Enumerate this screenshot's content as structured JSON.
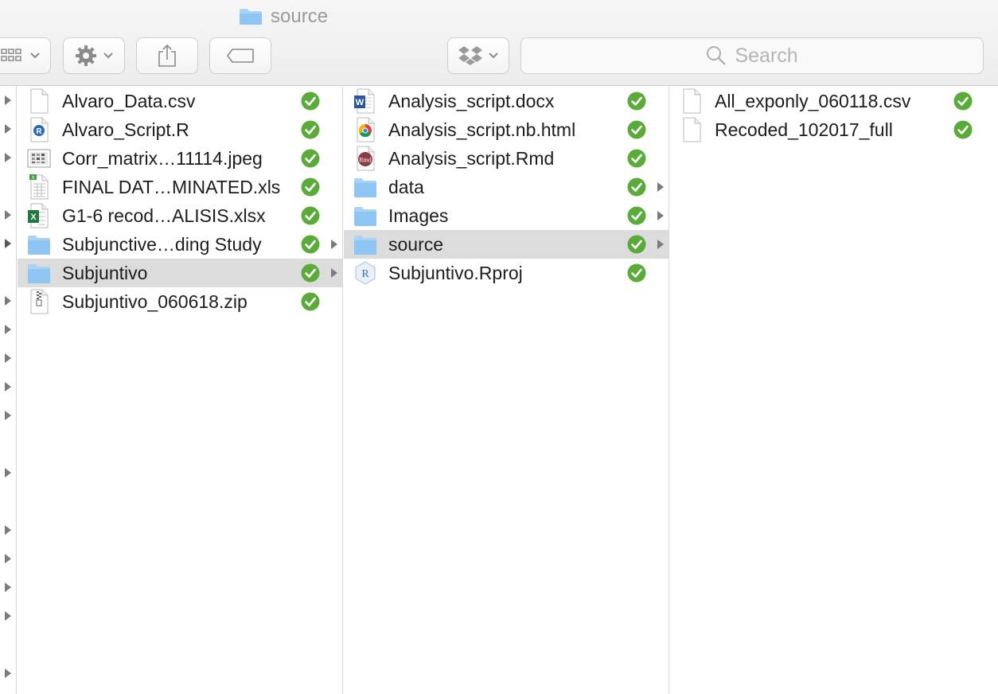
{
  "window": {
    "title": "source"
  },
  "toolbar": {
    "view_button": "view-options",
    "action_button": "action-menu",
    "share_button": "share",
    "tags_button": "tags",
    "dropbox_button": "dropbox-menu",
    "search_placeholder": "Search"
  },
  "columns": [
    {
      "items": [
        {
          "name": "Alvaro_Data.csv",
          "icon": "blank-document-icon",
          "synced": true,
          "folder": false,
          "selected": false
        },
        {
          "name": "Alvaro_Script.R",
          "icon": "r-script-icon",
          "synced": true,
          "folder": false,
          "selected": false
        },
        {
          "name": "Corr_matrix…11114.jpeg",
          "icon": "image-file-icon",
          "synced": true,
          "folder": false,
          "selected": false
        },
        {
          "name": "FINAL DAT…MINATED.xls",
          "icon": "spreadsheet-icon",
          "synced": true,
          "folder": false,
          "selected": false
        },
        {
          "name": "G1-6 recod…ALISIS.xlsx",
          "icon": "excel-icon",
          "synced": true,
          "folder": false,
          "selected": false
        },
        {
          "name": "Subjunctive…ding Study",
          "icon": "folder-icon",
          "synced": true,
          "folder": true,
          "selected": false
        },
        {
          "name": "Subjuntivo",
          "icon": "folder-icon",
          "synced": true,
          "folder": true,
          "selected": true
        },
        {
          "name": "Subjuntivo_060618.zip",
          "icon": "zip-archive-icon",
          "synced": true,
          "folder": false,
          "selected": false
        }
      ]
    },
    {
      "items": [
        {
          "name": "Analysis_script.docx",
          "icon": "word-doc-icon",
          "synced": true,
          "folder": false,
          "selected": false
        },
        {
          "name": "Analysis_script.nb.html",
          "icon": "chrome-html-icon",
          "synced": true,
          "folder": false,
          "selected": false
        },
        {
          "name": "Analysis_script.Rmd",
          "icon": "rmd-icon",
          "synced": true,
          "folder": false,
          "selected": false
        },
        {
          "name": "data",
          "icon": "folder-icon",
          "synced": true,
          "folder": true,
          "selected": false
        },
        {
          "name": "Images",
          "icon": "folder-icon",
          "synced": true,
          "folder": true,
          "selected": false
        },
        {
          "name": "source",
          "icon": "folder-icon",
          "synced": true,
          "folder": true,
          "selected": true
        },
        {
          "name": "Subjuntivo.Rproj",
          "icon": "rproj-icon",
          "synced": true,
          "folder": false,
          "selected": false
        }
      ]
    },
    {
      "items": [
        {
          "name": "All_exponly_060118.csv",
          "icon": "blank-document-icon",
          "synced": true,
          "folder": false,
          "selected": false
        },
        {
          "name": "Recoded_102017_full",
          "icon": "blank-document-icon",
          "synced": true,
          "folder": false,
          "selected": false
        }
      ]
    }
  ],
  "colors": {
    "folder": "#8ec5f2",
    "check": "#5aab3a",
    "selection": "#dcdcdc"
  }
}
